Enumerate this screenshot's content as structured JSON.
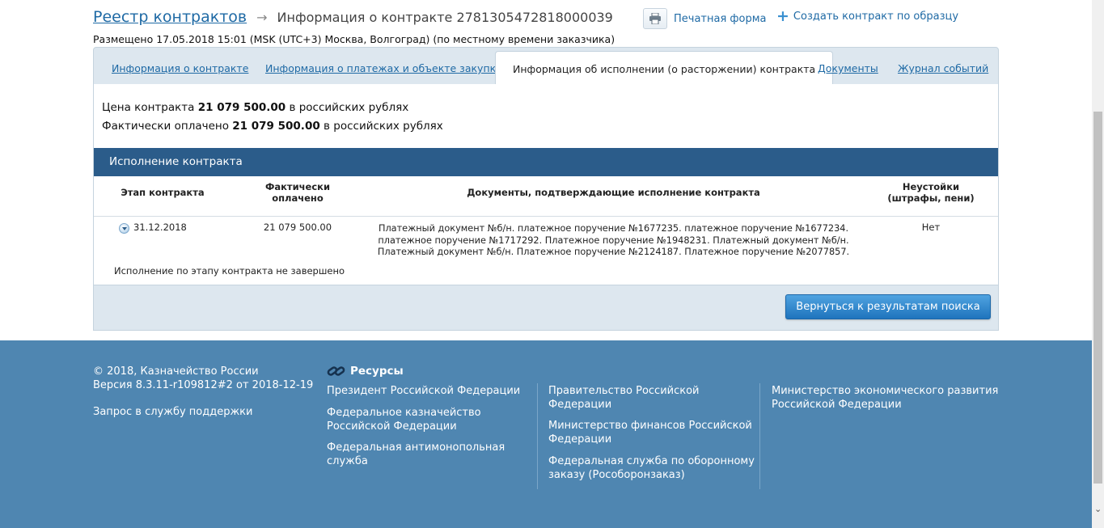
{
  "header": {
    "breadcrumb_link": "Реестр контрактов",
    "breadcrumb_current": "Информация о контракте 2781305472818000039",
    "placed_info": "Размещено 17.05.2018 15:01 (MSK (UTC+3) Москва, Волгоград) (по местному времени заказчика)",
    "print_label": "Печатная форма",
    "create_label": "Создать контракт по образцу"
  },
  "tabs": [
    {
      "label": "Информация о контракте"
    },
    {
      "label": "Информация о платежах и объекте закупки"
    },
    {
      "label": "Информация об исполнении (о расторжении) контракта"
    },
    {
      "label": "Документы"
    },
    {
      "label": "Журнал событий"
    }
  ],
  "prices": {
    "price_prefix": "Цена контракта",
    "price_value": "21 079 500.00",
    "price_suffix": "в российских рублях",
    "paid_prefix": "Фактически оплачено",
    "paid_value": "21 079 500.00",
    "paid_suffix": "в российских рублях"
  },
  "execution": {
    "title": "Исполнение контракта",
    "columns": {
      "stage": "Этап контракта",
      "paid_line1": "Фактически",
      "paid_line2": "оплачено",
      "documents": "Документы, подтверждающие исполнение контракта",
      "penalties_line1": "Неустойки",
      "penalties_line2": "(штрафы, пени)"
    },
    "row": {
      "stage": "31.12.2018",
      "paid": "21 079 500.00",
      "docs_line1": "Платежный документ №б/н. платежное поручение №1677235. платежное поручение №1677234.",
      "docs_line2": "платежное поручение №1717292. Платежное поручение №1948231. Платежный документ №б/н.",
      "docs_line3": "Платежный документ №б/н. Платежное поручение №2124187. Платежное поручение №2077857.",
      "penalties": "Нет"
    },
    "status_note": "Исполнение по этапу контракта не завершено"
  },
  "back_button": "Вернуться к результатам поиска",
  "footer": {
    "copyright": "© 2018, Казначейство России",
    "version": "Версия 8.3.11-r109812#2 от 2018-12-19",
    "support": "Запрос в службу поддержки",
    "resources_title": "Ресурсы",
    "links_col1": [
      {
        "line1": "Президент Российской Федерации",
        "line2": ""
      },
      {
        "line1": "Федеральное казначейство",
        "line2": "Российской Федерации"
      },
      {
        "line1": "Федеральная антимонопольная",
        "line2": "служба"
      }
    ],
    "links_col2": [
      {
        "line1": "Правительство Российской",
        "line2": "Федерации"
      },
      {
        "line1": "Министерство финансов Российской",
        "line2": "Федерации"
      },
      {
        "line1": "Федеральная служба по оборонному",
        "line2": "заказу (Рособоронзаказ)"
      }
    ],
    "links_col3": [
      {
        "line1": "Министерство экономического развития",
        "line2": "Российской Федерации"
      }
    ]
  },
  "colors": {
    "accent": "#1f6aa5",
    "section_bar": "#2b5c8a",
    "footer_bg": "#4f86b1",
    "button": "#2a84cc"
  }
}
